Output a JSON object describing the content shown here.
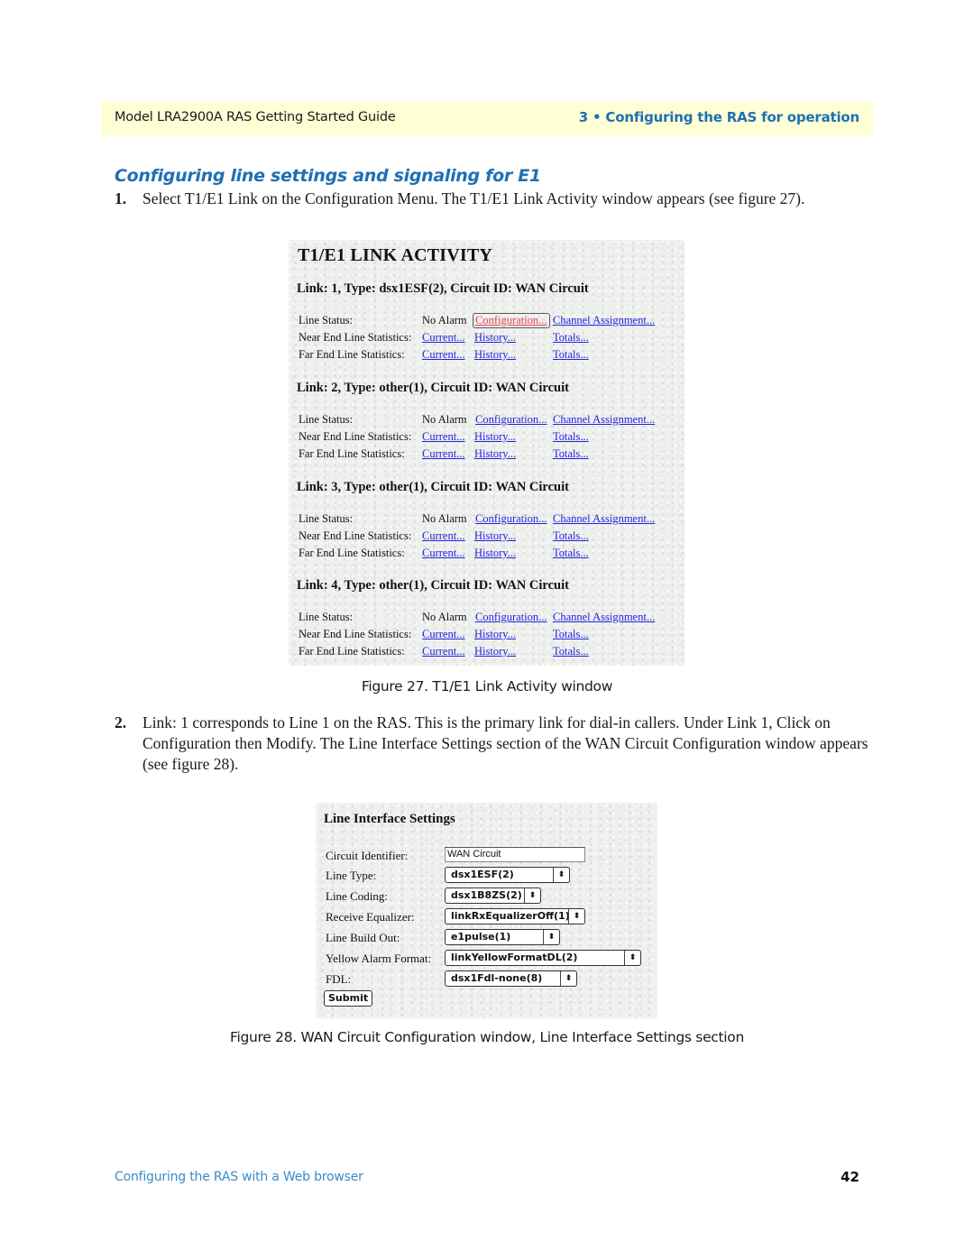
{
  "header": {
    "left": "Model LRA2900A RAS Getting Started Guide",
    "right": "3 • Configuring the RAS for operation"
  },
  "section_title": "Configuring line settings and signaling for E1",
  "steps": [
    {
      "num": "1.",
      "text": "Select T1/E1 Link on the Configuration Menu. The T1/E1 Link Activity window appears (see figure 27)."
    },
    {
      "num": "2.",
      "text": "Link: 1 corresponds to Line 1 on the RAS. This is the primary link for dial-in callers. Under Link 1, Click on Configuration then Modify. The Line Interface Settings section of the WAN Circuit Configuration window appears (see figure 28)."
    }
  ],
  "figure27": {
    "title": "T1/E1 LINK ACTIVITY",
    "caption": "Figure 27. T1/E1 Link Activity window",
    "links": [
      {
        "heading": "Link: 1, Type: dsx1ESF(2), Circuit ID: WAN Circuit",
        "line_status_label": "Line Status:",
        "line_status": "No Alarm",
        "configuration": "Configuration...",
        "channel_assignment": "Channel Assignment...",
        "near_label": "Near End Line Statistics:",
        "far_label": "Far End Line Statistics:",
        "current": "Current...",
        "history": "History...",
        "totals": "Totals..."
      },
      {
        "heading": "Link: 2, Type: other(1), Circuit ID: WAN Circuit",
        "line_status_label": "Line Status:",
        "line_status": "No Alarm",
        "configuration": "Configuration...",
        "channel_assignment": "Channel Assignment...",
        "near_label": "Near End Line Statistics:",
        "far_label": "Far End Line Statistics:",
        "current": "Current...",
        "history": "History...",
        "totals": "Totals..."
      },
      {
        "heading": "Link: 3, Type: other(1), Circuit ID: WAN Circuit",
        "line_status_label": "Line Status:",
        "line_status": "No Alarm",
        "configuration": "Configuration...",
        "channel_assignment": "Channel Assignment...",
        "near_label": "Near End Line Statistics:",
        "far_label": "Far End Line Statistics:",
        "current": "Current...",
        "history": "History...",
        "totals": "Totals..."
      },
      {
        "heading": "Link: 4, Type: other(1), Circuit ID: WAN Circuit",
        "line_status_label": "Line Status:",
        "line_status": "No Alarm",
        "configuration": "Configuration...",
        "channel_assignment": "Channel Assignment...",
        "near_label": "Near End Line Statistics:",
        "far_label": "Far End Line Statistics:",
        "current": "Current...",
        "history": "History...",
        "totals": "Totals..."
      }
    ]
  },
  "figure28": {
    "title": "Line Interface Settings",
    "caption": "Figure 28. WAN Circuit Configuration window, Line Interface Settings section",
    "fields": {
      "circuit_identifier": {
        "label": "Circuit Identifier:",
        "value": "WAN Circuit"
      },
      "line_type": {
        "label": "Line Type:",
        "value": "dsx1ESF(2)"
      },
      "line_coding": {
        "label": "Line Coding:",
        "value": "dsx1B8ZS(2)"
      },
      "receive_equalizer": {
        "label": "Receive Equalizer:",
        "value": "linkRxEqualizerOff(1)"
      },
      "line_build_out": {
        "label": "Line Build Out:",
        "value": "e1pulse(1)"
      },
      "yellow_alarm_format": {
        "label": "Yellow Alarm Format:",
        "value": "linkYellowFormatDL(2)"
      },
      "fdl": {
        "label": "FDL:",
        "value": "dsx1Fdl-none(8)"
      }
    },
    "submit_label": "Submit",
    "select_arrow_icon": "⬍"
  },
  "footer": {
    "left": "Configuring the RAS with a Web browser",
    "page_number": "42"
  }
}
